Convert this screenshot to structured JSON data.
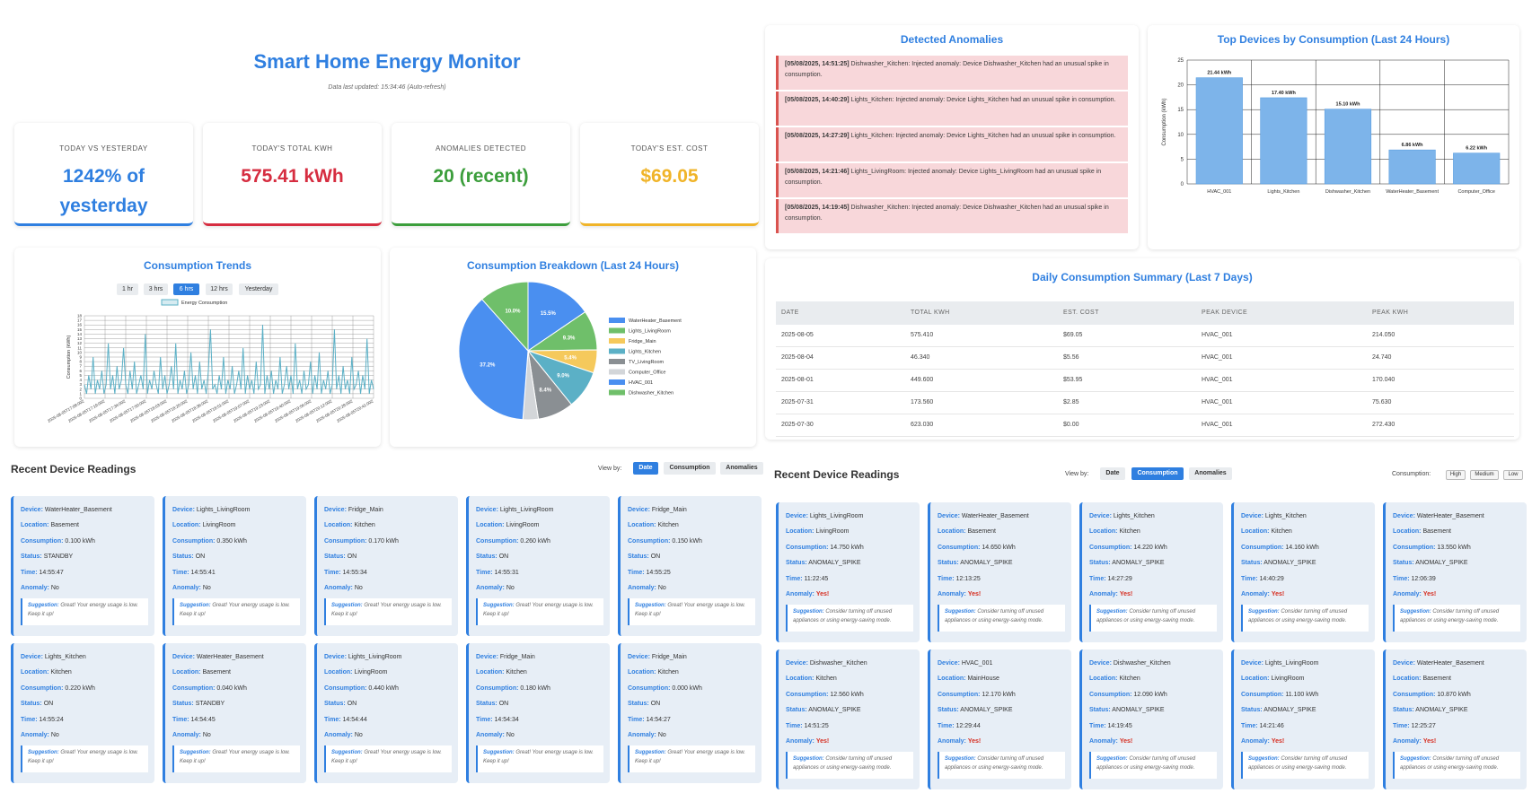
{
  "header": {
    "title": "Smart Home Energy Monitor",
    "updated": "Data last updated: 15:34:46 (Auto-refresh)"
  },
  "stats": [
    {
      "label": "Today vs Yesterday",
      "value": "1242% of yesterday",
      "color": "#2f7fe0"
    },
    {
      "label": "Today's Total kWh",
      "value": "575.41 kWh",
      "color": "#d62d40"
    },
    {
      "label": "Anomalies Detected",
      "value": "20 (recent)",
      "color": "#3c9e3c"
    },
    {
      "label": "Today's Est. Cost",
      "value": "$69.05",
      "color": "#f0b429"
    }
  ],
  "anomalies": {
    "title": "Detected Anomalies",
    "items": [
      {
        "time": "[05/08/2025, 14:51:25]",
        "text": " Dishwasher_Kitchen: Injected anomaly: Device Dishwasher_Kitchen had an unusual spike in consumption."
      },
      {
        "time": "[05/08/2025, 14:40:29]",
        "text": " Lights_Kitchen: Injected anomaly: Device Lights_Kitchen had an unusual spike in consumption."
      },
      {
        "time": "[05/08/2025, 14:27:29]",
        "text": " Lights_Kitchen: Injected anomaly: Device Lights_Kitchen had an unusual spike in consumption."
      },
      {
        "time": "[05/08/2025, 14:21:46]",
        "text": " Lights_LivingRoom: Injected anomaly: Device Lights_LivingRoom had an unusual spike in consumption."
      },
      {
        "time": "[05/08/2025, 14:19:45]",
        "text": " Dishwasher_Kitchen: Injected anomaly: Device Dishwasher_Kitchen had an unusual spike in consumption."
      }
    ]
  },
  "trends": {
    "title": "Consumption Trends",
    "buttons": [
      "1 hr",
      "3 hrs",
      "6 hrs",
      "12 hrs",
      "Yesterday"
    ],
    "active": "6 hrs"
  },
  "summary": {
    "title": "Daily Consumption Summary (Last 7 Days)",
    "headers": [
      "DATE",
      "TOTAL KWH",
      "EST. COST",
      "PEAK DEVICE",
      "PEAK KWH"
    ],
    "rows": [
      [
        "2025-08-05",
        "575.410",
        "$69.05",
        "HVAC_001",
        "214.050"
      ],
      [
        "2025-08-04",
        "46.340",
        "$5.56",
        "HVAC_001",
        "24.740"
      ],
      [
        "2025-08-01",
        "449.600",
        "$53.95",
        "HVAC_001",
        "170.040"
      ],
      [
        "2025-07-31",
        "173.560",
        "$2.85",
        "HVAC_001",
        "75.630"
      ],
      [
        "2025-07-30",
        "623.030",
        "$0.00",
        "HVAC_001",
        "272.430"
      ]
    ]
  },
  "readings_left": {
    "title": "Recent Device Readings",
    "view_by": "View by:",
    "view_buttons": [
      "Date",
      "Consumption",
      "Anomalies"
    ],
    "active": "Date",
    "cards": [
      {
        "device": "WaterHeater_Basement",
        "location": "Basement",
        "consumption": "0.100 kWh",
        "status": "STANDBY",
        "time": "14:55:47",
        "anomaly": "No",
        "suggestion": "Great! Your energy usage is low. Keep it up!"
      },
      {
        "device": "Lights_LivingRoom",
        "location": "LivingRoom",
        "consumption": "0.350 kWh",
        "status": "ON",
        "time": "14:55:41",
        "anomaly": "No",
        "suggestion": "Great! Your energy usage is low. Keep it up!"
      },
      {
        "device": "Fridge_Main",
        "location": "Kitchen",
        "consumption": "0.170 kWh",
        "status": "ON",
        "time": "14:55:34",
        "anomaly": "No",
        "suggestion": "Great! Your energy usage is low. Keep it up!"
      },
      {
        "device": "Lights_LivingRoom",
        "location": "LivingRoom",
        "consumption": "0.260 kWh",
        "status": "ON",
        "time": "14:55:31",
        "anomaly": "No",
        "suggestion": "Great! Your energy usage is low. Keep it up!"
      },
      {
        "device": "Fridge_Main",
        "location": "Kitchen",
        "consumption": "0.150 kWh",
        "status": "ON",
        "time": "14:55:25",
        "anomaly": "No",
        "suggestion": "Great! Your energy usage is low. Keep it up!"
      },
      {
        "device": "Lights_Kitchen",
        "location": "Kitchen",
        "consumption": "0.220 kWh",
        "status": "ON",
        "time": "14:55:24",
        "anomaly": "No",
        "suggestion": "Great! Your energy usage is low. Keep it up!"
      },
      {
        "device": "WaterHeater_Basement",
        "location": "Basement",
        "consumption": "0.040 kWh",
        "status": "STANDBY",
        "time": "14:54:45",
        "anomaly": "No",
        "suggestion": "Great! Your energy usage is low. Keep it up!"
      },
      {
        "device": "Lights_LivingRoom",
        "location": "LivingRoom",
        "consumption": "0.440 kWh",
        "status": "ON",
        "time": "14:54:44",
        "anomaly": "No",
        "suggestion": "Great! Your energy usage is low. Keep it up!"
      },
      {
        "device": "Fridge_Main",
        "location": "Kitchen",
        "consumption": "0.180 kWh",
        "status": "ON",
        "time": "14:54:34",
        "anomaly": "No",
        "suggestion": "Great! Your energy usage is low. Keep it up!"
      },
      {
        "device": "Fridge_Main",
        "location": "Kitchen",
        "consumption": "0.000 kWh",
        "status": "ON",
        "time": "14:54:27",
        "anomaly": "No",
        "suggestion": "Great! Your energy usage is low. Keep it up!"
      }
    ]
  },
  "readings_right": {
    "title": "Recent Device Readings",
    "view_by": "View by:",
    "view_buttons": [
      "Date",
      "Consumption",
      "Anomalies"
    ],
    "active": "Consumption",
    "consumption_label": "Consumption:",
    "consumption_buttons": [
      "High",
      "Medium",
      "Low"
    ],
    "cards": [
      {
        "device": "Lights_LivingRoom",
        "location": "LivingRoom",
        "consumption": "14.750 kWh",
        "status": "ANOMALY_SPIKE",
        "time": "11:22:45",
        "anomaly": "Yes!",
        "suggestion": "Consider turning off unused appliances or using energy-saving mode."
      },
      {
        "device": "WaterHeater_Basement",
        "location": "Basement",
        "consumption": "14.650 kWh",
        "status": "ANOMALY_SPIKE",
        "time": "12:13:25",
        "anomaly": "Yes!",
        "suggestion": "Consider turning off unused appliances or using energy-saving mode."
      },
      {
        "device": "Lights_Kitchen",
        "location": "Kitchen",
        "consumption": "14.220 kWh",
        "status": "ANOMALY_SPIKE",
        "time": "14:27:29",
        "anomaly": "Yes!",
        "suggestion": "Consider turning off unused appliances or using energy-saving mode."
      },
      {
        "device": "Lights_Kitchen",
        "location": "Kitchen",
        "consumption": "14.160 kWh",
        "status": "ANOMALY_SPIKE",
        "time": "14:40:29",
        "anomaly": "Yes!",
        "suggestion": "Consider turning off unused appliances or using energy-saving mode."
      },
      {
        "device": "WaterHeater_Basement",
        "location": "Basement",
        "consumption": "13.550 kWh",
        "status": "ANOMALY_SPIKE",
        "time": "12:06:39",
        "anomaly": "Yes!",
        "suggestion": "Consider turning off unused appliances or using energy-saving mode."
      },
      {
        "device": "Dishwasher_Kitchen",
        "location": "Kitchen",
        "consumption": "12.560 kWh",
        "status": "ANOMALY_SPIKE",
        "time": "14:51:25",
        "anomaly": "Yes!",
        "suggestion": "Consider turning off unused appliances or using energy-saving mode."
      },
      {
        "device": "HVAC_001",
        "location": "MainHouse",
        "consumption": "12.170 kWh",
        "status": "ANOMALY_SPIKE",
        "time": "12:29:44",
        "anomaly": "Yes!",
        "suggestion": "Consider turning off unused appliances or using energy-saving mode."
      },
      {
        "device": "Dishwasher_Kitchen",
        "location": "Kitchen",
        "consumption": "12.090 kWh",
        "status": "ANOMALY_SPIKE",
        "time": "14:19:45",
        "anomaly": "Yes!",
        "suggestion": "Consider turning off unused appliances or using energy-saving mode."
      },
      {
        "device": "Lights_LivingRoom",
        "location": "LivingRoom",
        "consumption": "11.100 kWh",
        "status": "ANOMALY_SPIKE",
        "time": "14:21:46",
        "anomaly": "Yes!",
        "suggestion": "Consider turning off unused appliances or using energy-saving mode."
      },
      {
        "device": "WaterHeater_Basement",
        "location": "Basement",
        "consumption": "10.870 kWh",
        "status": "ANOMALY_SPIKE",
        "time": "12:25:27",
        "anomaly": "Yes!",
        "suggestion": "Consider turning off unused appliances or using energy-saving mode."
      }
    ]
  },
  "card_labels": {
    "device": "Device:",
    "location": "Location:",
    "consumption": "Consumption:",
    "status": "Status:",
    "time": "Time:",
    "anomaly": "Anomaly:",
    "suggestion": "Suggestion:"
  },
  "chart_data": [
    {
      "type": "bar",
      "title": "Top Devices by Consumption (Last 24 Hours)",
      "ylabel": "Consumption (kWh)",
      "categories": [
        "HVAC_001",
        "Lights_Kitchen",
        "Dishwasher_Kitchen",
        "WaterHeater_Basement",
        "Computer_Office"
      ],
      "values": [
        21.44,
        17.4,
        15.1,
        6.86,
        6.22
      ],
      "value_labels": [
        "21.44 kWh",
        "17.40 kWh",
        "15.10 kWh",
        "6.86 kWh",
        "6.22 kWh"
      ],
      "ylim": [
        0,
        25
      ],
      "yticks": [
        0,
        5,
        10,
        15,
        20,
        25
      ],
      "grid": true,
      "color": "#7db4ea"
    },
    {
      "type": "pie",
      "title": "Consumption Breakdown (Last 24 Hours)",
      "legend_position": "right",
      "slices": [
        {
          "label": "WaterHeater_Basement",
          "value": 15.5,
          "text": "15.5%",
          "color": "#4a8ff0"
        },
        {
          "label": "Lights_LivingRoom",
          "value": 9.3,
          "text": "9.3%",
          "color": "#6fbf6a"
        },
        {
          "label": "Fridge_Main",
          "value": 5.4,
          "text": "5.4%",
          "color": "#f5c95c"
        },
        {
          "label": "Lights_Kitchen",
          "value": 9.0,
          "text": "9.0%",
          "color": "#5bb0c6"
        },
        {
          "label": "TV_LivingRoom",
          "value": 8.4,
          "text": "8.4%",
          "color": "#8a8f93"
        },
        {
          "label": "Computer_Office",
          "value": 3.6,
          "text": "",
          "color": "#d3d6d9"
        },
        {
          "label": "HVAC_001",
          "value": 37.2,
          "text": "37.2%",
          "color": "#4a8ff0"
        },
        {
          "label": "Dishwasher_Kitchen",
          "value": 11.6,
          "text": "10.0%",
          "color": "#6fbf6a"
        }
      ]
    },
    {
      "type": "line",
      "title": "Consumption Trends",
      "legend": "Energy Consumption",
      "ylabel": "Consumption (kWh)",
      "ylim": [
        0,
        18
      ],
      "yticks": [
        0,
        1,
        2,
        3,
        4,
        5,
        6,
        7,
        8,
        9,
        10,
        11,
        12,
        13,
        14,
        15,
        16,
        17,
        18
      ],
      "xticks": [
        "2025-08-05T17:08:00Z",
        "2025-08-05T17:19:00Z",
        "2025-08-05T17:34:00Z",
        "2025-08-05T17:50:00Z",
        "2025-08-05T18:03:00Z",
        "2025-08-05T18:20:00Z",
        "2025-08-05T18:36:00Z",
        "2025-08-05T18:51:00Z",
        "2025-08-05T19:07:00Z",
        "2025-08-05T19:23:00Z",
        "2025-08-05T19:40:00Z",
        "2025-08-05T19:56:00Z",
        "2025-08-05T20:12:00Z",
        "2025-08-05T20:28:00Z",
        "2025-08-05T20:41:00Z"
      ],
      "values": [
        3,
        1,
        5,
        2,
        9,
        1,
        4,
        2,
        6,
        1,
        3,
        12,
        2,
        5,
        1,
        7,
        2,
        4,
        11,
        3,
        1,
        6,
        2,
        8,
        1,
        3,
        5,
        2,
        14,
        1,
        4,
        2,
        6,
        3,
        1,
        9,
        2,
        5,
        1,
        3,
        7,
        2,
        12,
        1,
        4,
        2,
        6,
        1,
        3,
        10,
        2,
        5,
        1,
        8,
        2,
        4,
        1,
        6,
        15,
        2,
        3,
        1,
        5,
        2,
        9,
        1,
        4,
        2,
        7,
        1,
        3,
        6,
        2,
        11,
        1,
        5,
        2,
        4,
        1,
        8,
        2,
        3,
        16,
        1,
        5,
        2,
        6,
        1,
        4,
        2,
        9,
        1,
        3,
        7,
        2,
        5,
        1,
        12,
        2,
        4,
        1,
        6,
        2,
        3,
        8,
        1,
        5,
        2,
        10,
        1,
        4,
        2,
        6,
        1,
        3,
        15,
        2,
        5,
        1,
        7,
        2,
        4,
        1,
        9,
        2,
        3,
        6,
        1,
        5,
        2,
        13,
        1,
        4,
        2
      ]
    }
  ]
}
